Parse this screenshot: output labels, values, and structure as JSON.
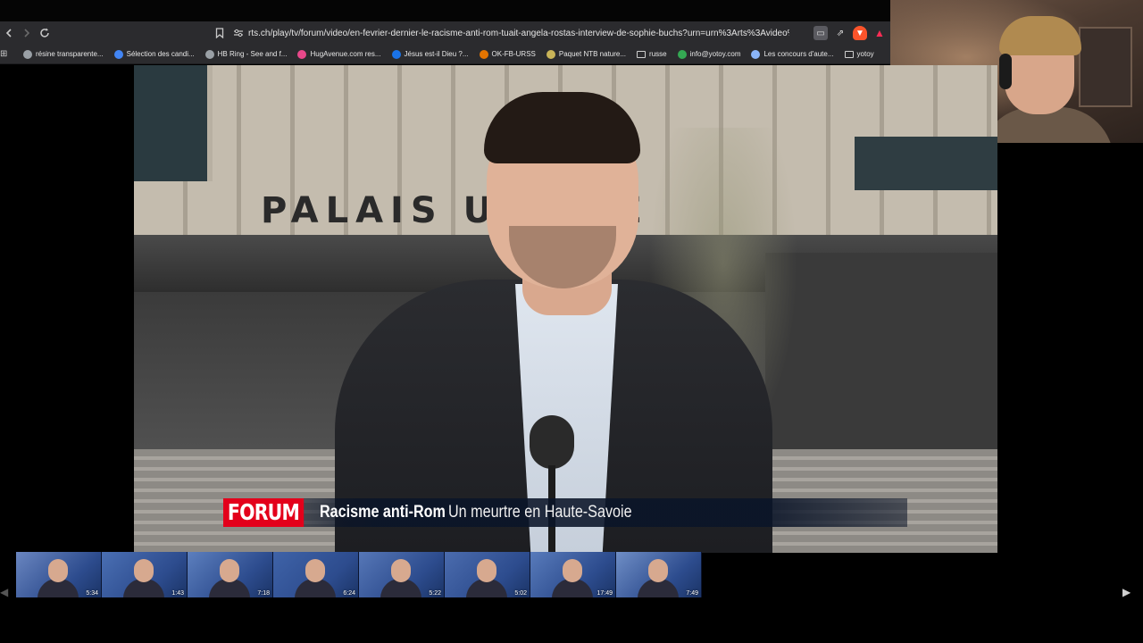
{
  "browser": {
    "url": "rts.ch/play/tv/forum/video/en-fevrier-dernier-le-racisme-anti-rom-tuait-angela-rostas-interview-de-sophie-buchs?urn=urn%3Arts%3Avideo%3..."
  },
  "bookmarks": [
    {
      "label": "résine transparente...",
      "color": "#9aa0a6"
    },
    {
      "label": "Sélection des candi...",
      "color": "#4285f4"
    },
    {
      "label": "HB Ring - See and f...",
      "color": "#9aa0a6"
    },
    {
      "label": "HugAvenue.com res...",
      "color": "#e8488a"
    },
    {
      "label": "Jésus est-il Dieu ?...",
      "color": "#1a73e8"
    },
    {
      "label": "OK-FB-URSS",
      "color": "#e37400"
    },
    {
      "label": "Paquet NTB nature...",
      "color": "#c9b458"
    },
    {
      "label": "russe",
      "color": "folder"
    },
    {
      "label": "info@yotoy.com",
      "color": "#34a853"
    },
    {
      "label": "Les concours d'aute...",
      "color": "#8ab4f8"
    },
    {
      "label": "yotoy",
      "color": "folder"
    }
  ],
  "video": {
    "sign": "PALAIS   USTICE",
    "show_logo": "FORUM",
    "headline": "Racisme anti-Rom",
    "subheadline": "Un meurtre en Haute-Savoie"
  },
  "thumbnails": [
    {
      "duration": "5:34"
    },
    {
      "duration": "1:43"
    },
    {
      "duration": "7:18"
    },
    {
      "duration": "6:24"
    },
    {
      "duration": "5:22"
    },
    {
      "duration": "5:02"
    },
    {
      "duration": "17:49"
    },
    {
      "duration": "7:49"
    }
  ],
  "icons": {
    "back": "chevron-left-icon",
    "forward": "chevron-right-icon",
    "reload": "reload-icon",
    "bookmark": "bookmark-icon",
    "site_info": "tune-icon",
    "cast": "cast-icon",
    "share": "share-icon",
    "brave": "brave-shield-icon",
    "rewards": "brave-rewards-icon"
  }
}
